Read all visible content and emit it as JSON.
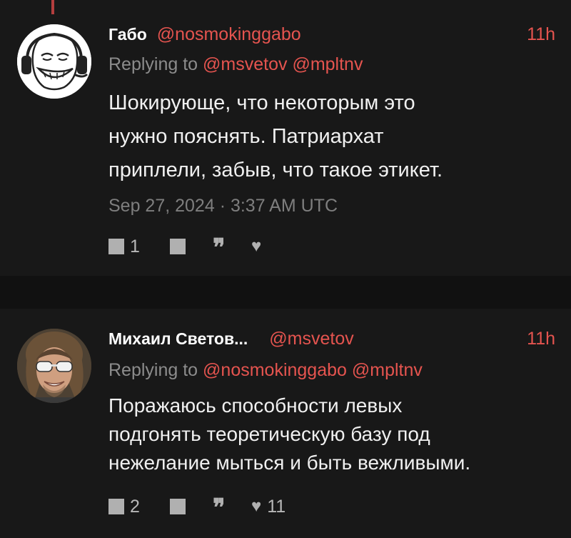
{
  "tweets": [
    {
      "name": "Габо",
      "handle": "@nosmokinggabo",
      "time": "11h",
      "replying_prefix": "Replying to",
      "replying_mentions": [
        "@msvetov",
        "@mpltnv"
      ],
      "text_lines": [
        "Шокирующе, что некоторым это",
        "нужно пояснять. Патриархат",
        "приплели, забыв, что такое этикет."
      ],
      "date": "Sep 27, 2024 · 3:37 AM UTC",
      "actions": {
        "comment_icon": "comment-icon",
        "comment_count": "1",
        "retweet_icon": "retweet-icon",
        "quote_icon": "quote-icon",
        "quote_glyph": "❞",
        "like_icon": "heart-icon",
        "like_glyph": "♥",
        "like_count": ""
      }
    },
    {
      "name": "Михаил Светов...",
      "handle": "@msvetov",
      "time": "11h",
      "replying_prefix": "Replying to",
      "replying_mentions": [
        "@nosmokinggabo",
        "@mpltnv"
      ],
      "text_lines": [
        "Поражаюсь способности левых",
        "подгонять теоретическую базу под",
        "нежелание мыться и быть вежливыми."
      ],
      "actions": {
        "comment_icon": "comment-icon",
        "comment_count": "2",
        "retweet_icon": "retweet-icon",
        "quote_icon": "quote-icon",
        "quote_glyph": "❞",
        "like_icon": "heart-icon",
        "like_glyph": "♥",
        "like_count": "11"
      }
    }
  ],
  "colors": {
    "accent": "#e5544f",
    "background": "#181818",
    "separator": "#111111",
    "muted": "#8c8c8c"
  }
}
